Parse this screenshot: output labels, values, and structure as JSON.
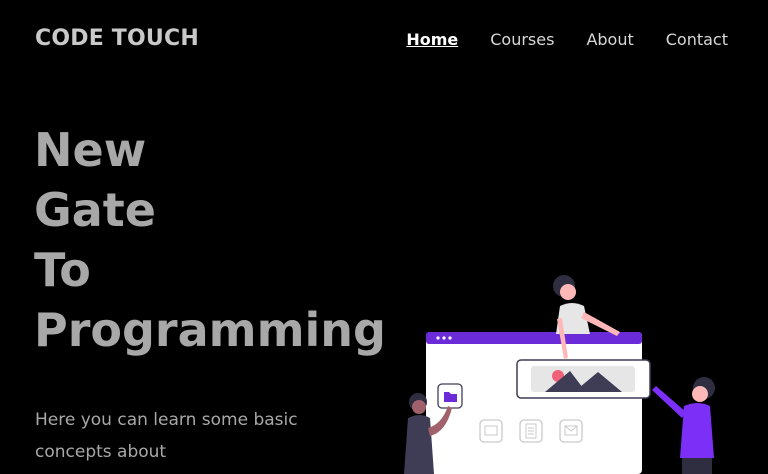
{
  "brand": {
    "name": "CODE TOUCH"
  },
  "nav": {
    "items": [
      "Home",
      "Courses",
      "About",
      "Contact"
    ],
    "active": "Home"
  },
  "hero": {
    "headline_lines": [
      "New",
      "Gate",
      "To",
      "Programming"
    ],
    "description": "Here you can learn some basic concepts about"
  },
  "colors": {
    "background": "#000000",
    "headline": "#a8a8a8",
    "accent_purple": "#6c2bd9",
    "figure_purple": "#7b2ff7",
    "accent_pink": "#f06277"
  },
  "illustration": {
    "name": "people-browser-illustration"
  }
}
